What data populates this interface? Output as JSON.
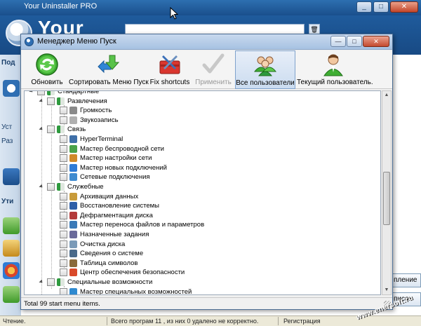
{
  "background_app": {
    "title": "Your Uninstaller PRO",
    "brand": "Your",
    "sidebar_tabs": [
      "Под",
      "Уст",
      "Раз",
      "Ути"
    ],
    "right_buttons": [
      "пление",
      "писок"
    ]
  },
  "status_bar": {
    "left": "Чтение.",
    "middle": "Всего програм 11 , из них 0 удалено не корректно.",
    "right": "Регистрация"
  },
  "watermark": "www.enersoft.ru",
  "dialog": {
    "title": "Менеджер Меню Пуск",
    "toolbar": [
      {
        "id": "refresh",
        "label": "Обновить",
        "icon": "refresh-icon",
        "enabled": true
      },
      {
        "id": "sort",
        "label": "Сортировать Меню Пуск",
        "icon": "sort-icon",
        "enabled": true
      },
      {
        "id": "fix",
        "label": "Fix shortcuts",
        "icon": "toolbox-icon",
        "enabled": true
      },
      {
        "id": "apply",
        "label": "Применить",
        "icon": "checkmark-icon",
        "enabled": false
      },
      {
        "id": "all_users",
        "label": "Все пользователи",
        "icon": "users-icon",
        "enabled": true,
        "active": true
      },
      {
        "id": "current_user",
        "label": "Текущий пользователь.",
        "icon": "user-icon",
        "enabled": true
      }
    ],
    "tree": [
      {
        "level": 1,
        "label": "Стандартные",
        "type": "folder",
        "partial": true
      },
      {
        "level": 2,
        "label": "Развлечения",
        "type": "folder",
        "expanded": true
      },
      {
        "level": 3,
        "label": "Громкость",
        "type": "item",
        "icon": "speaker-icon"
      },
      {
        "level": 3,
        "label": "Звукозапись",
        "type": "item",
        "icon": "mic-icon"
      },
      {
        "level": 2,
        "label": "Связь",
        "type": "folder",
        "expanded": true
      },
      {
        "level": 3,
        "label": "HyperTerminal",
        "type": "item",
        "icon": "terminal-icon"
      },
      {
        "level": 3,
        "label": "Мастер беспроводной сети",
        "type": "item",
        "icon": "wireless-icon"
      },
      {
        "level": 3,
        "label": "Мастер настройки сети",
        "type": "item",
        "icon": "home-network-icon"
      },
      {
        "level": 3,
        "label": "Мастер новых подключений",
        "type": "item",
        "icon": "globe-icon"
      },
      {
        "level": 3,
        "label": "Сетевые подключения",
        "type": "item",
        "icon": "network-icon"
      },
      {
        "level": 2,
        "label": "Служебные",
        "type": "folder",
        "expanded": true
      },
      {
        "level": 3,
        "label": "Архивация данных",
        "type": "item",
        "icon": "backup-icon"
      },
      {
        "level": 3,
        "label": "Восстановление системы",
        "type": "item",
        "icon": "restore-icon"
      },
      {
        "level": 3,
        "label": "Дефрагментация диска",
        "type": "item",
        "icon": "defrag-icon"
      },
      {
        "level": 3,
        "label": "Мастер переноса файлов и параметров",
        "type": "item",
        "icon": "transfer-icon"
      },
      {
        "level": 3,
        "label": "Назначенные задания",
        "type": "item",
        "icon": "tasks-icon"
      },
      {
        "level": 3,
        "label": "Очистка диска",
        "type": "item",
        "icon": "cleanup-icon"
      },
      {
        "level": 3,
        "label": "Сведения о системе",
        "type": "item",
        "icon": "sysinfo-icon"
      },
      {
        "level": 3,
        "label": "Таблица символов",
        "type": "item",
        "icon": "charmap-icon"
      },
      {
        "level": 3,
        "label": "Центр обеспечения безопасности",
        "type": "item",
        "icon": "shield-icon"
      },
      {
        "level": 2,
        "label": "Специальные возможности",
        "type": "folder",
        "expanded": true
      },
      {
        "level": 3,
        "label": "Мастер специальных возможностей",
        "type": "item",
        "icon": "accessibility-icon"
      }
    ],
    "status": "Total 99 start menu items."
  },
  "colors": {
    "accent": "#1f5b9c",
    "folder_green": "#2e9a3e",
    "active_button": "#cbdcf0"
  }
}
